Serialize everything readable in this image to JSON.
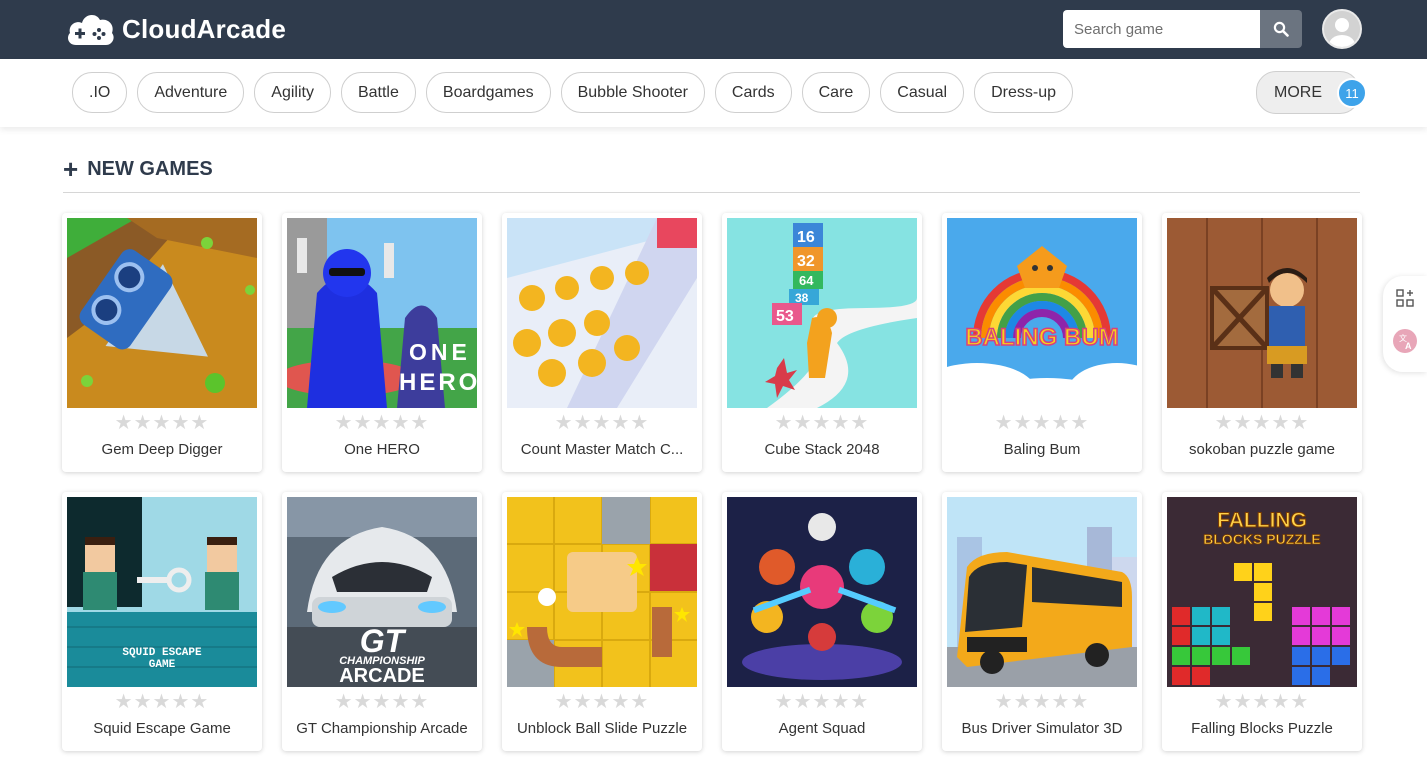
{
  "header": {
    "brand": "CloudArcade",
    "search_placeholder": "Search game"
  },
  "categories": [
    ".IO",
    "Adventure",
    "Agility",
    "Battle",
    "Boardgames",
    "Bubble Shooter",
    "Cards",
    "Care",
    "Casual",
    "Dress-up"
  ],
  "more": {
    "label": "MORE",
    "count": "11"
  },
  "section": {
    "title": "NEW GAMES"
  },
  "stars": "★★★★★",
  "games": [
    {
      "name": "Gem Deep Digger"
    },
    {
      "name": "One HERO",
      "thumb_text": [
        "ONE",
        "HERO"
      ]
    },
    {
      "name": "Count Master Match C..."
    },
    {
      "name": "Cube Stack 2048",
      "thumb_text": [
        "16",
        "32",
        "64",
        "38",
        "53"
      ]
    },
    {
      "name": "Baling Bum",
      "thumb_text": [
        "BALING BUM"
      ]
    },
    {
      "name": "sokoban puzzle game"
    },
    {
      "name": "Squid Escape Game",
      "thumb_text": [
        "SQUID ESCAPE",
        "GAME"
      ]
    },
    {
      "name": "GT Championship Arcade",
      "thumb_text": [
        "GT",
        "CHAMPIONSHIP",
        "ARCADE"
      ]
    },
    {
      "name": "Unblock Ball Slide Puzzle"
    },
    {
      "name": "Agent Squad"
    },
    {
      "name": "Bus Driver Simulator 3D"
    },
    {
      "name": "Falling Blocks Puzzle",
      "thumb_text": [
        "FALLING",
        "BLOCKS PUZZLE"
      ]
    }
  ],
  "colors": {
    "header": "#2f3b4c",
    "badge": "#3ea3ea",
    "star": "#d9d9d9"
  }
}
